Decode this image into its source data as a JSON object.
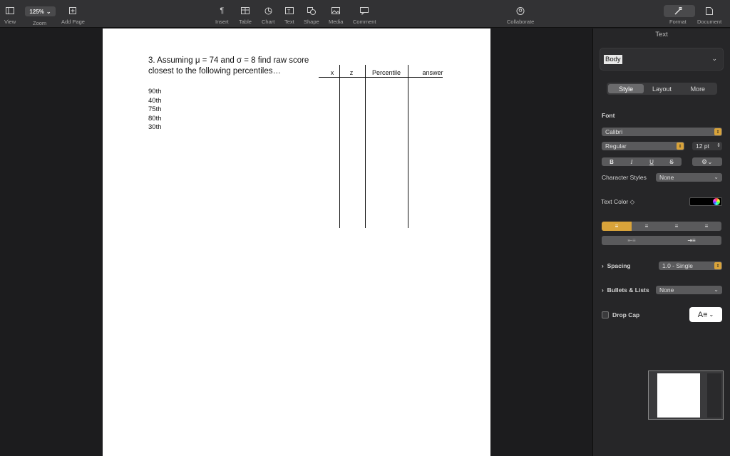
{
  "toolbar": {
    "view": "View",
    "zoom_value": "125%",
    "zoom": "Zoom",
    "add_page": "Add Page",
    "insert": "Insert",
    "table": "Table",
    "chart": "Chart",
    "text": "Text",
    "shape": "Shape",
    "media": "Media",
    "comment": "Comment",
    "collaborate": "Collaborate",
    "format": "Format",
    "document": "Document"
  },
  "document": {
    "question_line1": "3. Assuming  μ = 74 and  σ = 8 find raw score",
    "question_line2": "closest to the following percentiles…",
    "percentiles": [
      "90th",
      "40th",
      "75th",
      "80th",
      "30th"
    ],
    "columns": [
      "x",
      "z",
      "Percentile",
      "answer"
    ]
  },
  "inspector": {
    "title": "Text",
    "paragraph_style": "Body",
    "tabs": [
      "Style",
      "Layout",
      "More"
    ],
    "active_tab": "Style",
    "font_label": "Font",
    "font_name": "Calibri",
    "font_weight": "Regular",
    "font_size": "12 pt",
    "format_buttons": [
      "B",
      "I",
      "U",
      "S"
    ],
    "char_styles_label": "Character Styles",
    "char_styles_value": "None",
    "text_color_label": "Text Color ◇",
    "text_color": "#000000",
    "accent_color": "#d9a33a",
    "spacing_label": "Spacing",
    "spacing_value": "1.0 - Single",
    "bullets_label": "Bullets & Lists",
    "bullets_value": "None",
    "drop_cap_label": "Drop Cap"
  }
}
